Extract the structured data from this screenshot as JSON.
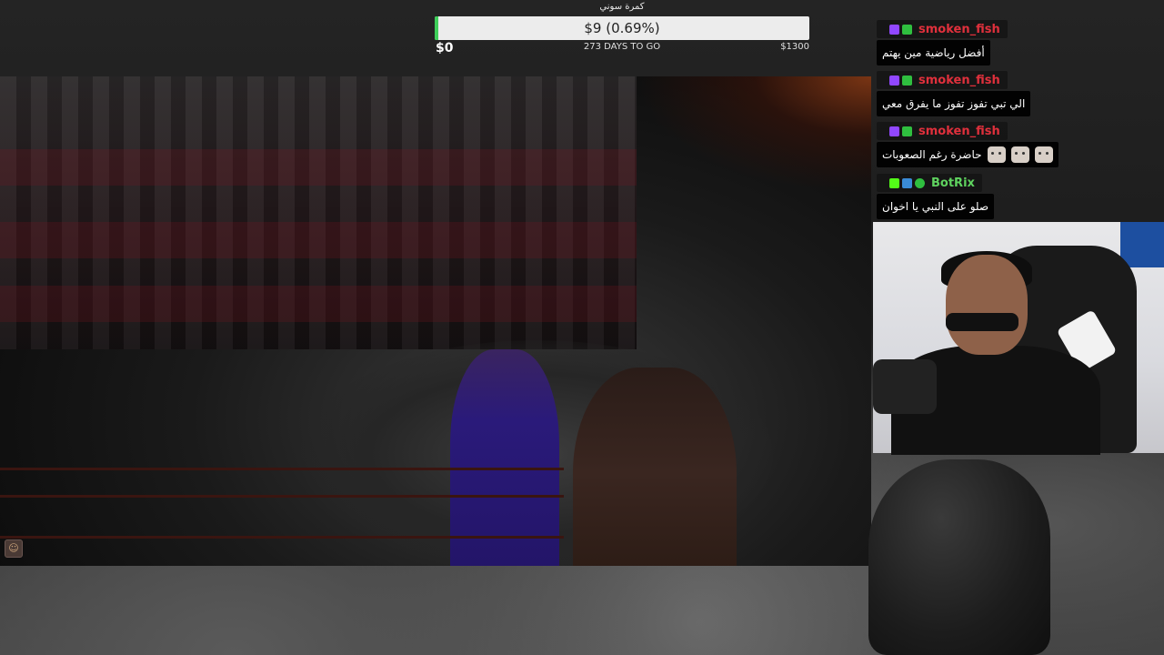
{
  "goal": {
    "title": "كمرة سوني",
    "amount_text": "$9 (0.69%)",
    "progress_percent": 0.69,
    "start_label": "$0",
    "days_label": "273 DAYS TO GO",
    "end_label": "$1300",
    "fill_color": "#3ecf5a"
  },
  "chat": {
    "messages": [
      {
        "username": "smoken_fish",
        "text": "أفضل رياضية مين يهتم",
        "name_color": "#e0303c",
        "badges": [
          "twitch-prime-icon",
          "verified-check-icon"
        ],
        "emotes": 0
      },
      {
        "username": "smoken_fish",
        "text": "الي تبي تفوز تفوز ما يفرق معي",
        "name_color": "#e0303c",
        "badges": [
          "twitch-prime-icon",
          "verified-check-icon"
        ],
        "emotes": 0
      },
      {
        "username": "smoken_fish",
        "text": "حاضرة رغم الصعوبات",
        "name_color": "#e0303c",
        "badges": [
          "twitch-prime-icon",
          "verified-check-icon"
        ],
        "emotes": 3
      },
      {
        "username": "BotRix",
        "text": "صلو على النبي يا اخوان",
        "name_color": "#5fd35f",
        "badges": [
          "kick-icon",
          "bot-icon",
          "verified-check-icon"
        ],
        "emotes": 0
      }
    ]
  },
  "video": {
    "corner_icon": "channel-logo-icon"
  }
}
